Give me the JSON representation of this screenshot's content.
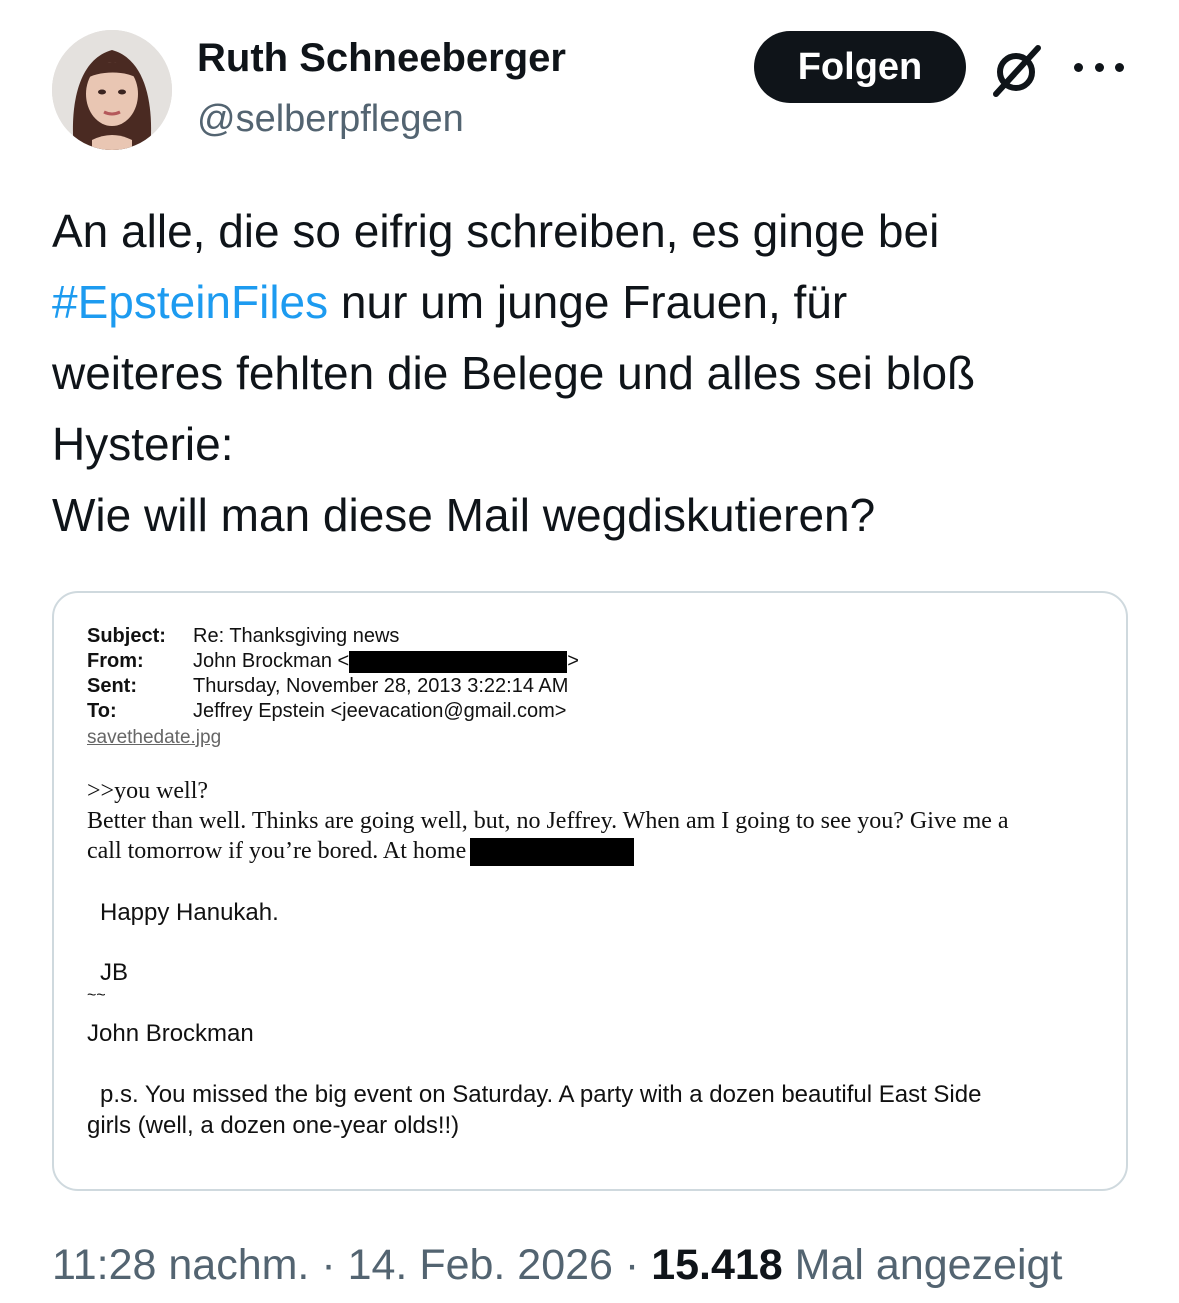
{
  "author": {
    "name": "Ruth Schneeberger",
    "handle": "@selberpflegen"
  },
  "actions": {
    "follow_label": "Folgen",
    "grok_icon": "grok-icon",
    "more_icon": "more-icon"
  },
  "tweet": {
    "line1": "An alle, die so eifrig schreiben, es ginge bei",
    "hashtag": "#EpsteinFiles",
    "line2_rest": " nur um junge Frauen, für",
    "line3": "weiteres fehlten die Belege und alles sei bloß",
    "line4": "Hysterie:",
    "line5": "Wie will man diese Mail wegdiskutieren?"
  },
  "email": {
    "subject_key": "Subject:",
    "subject": "Re: Thanksgiving news",
    "from_key": "From:",
    "from": "John Brockman <",
    "from_end": ">",
    "sent_key": "Sent:",
    "sent": "Thursday, November 28, 2013 3:22:14 AM",
    "to_key": "To:",
    "to": "Jeffrey Epstein <jeevacation@gmail.com>",
    "attachment": "savethedate.jpg",
    "quote": ">>you well?",
    "body1": "Better than well. Thinks are going well, but, no Jeffrey. When am I going to see you? Give me a",
    "body2": "call tomorrow if you’re bored. At home",
    "greeting": "Happy Hanukah.",
    "initials": "JB",
    "tilde": "~~",
    "signature": "John Brockman",
    "ps1": "p.s. You missed the big event on Saturday. A party with a dozen beautiful East Side",
    "ps2": "girls (well, a dozen one-year olds!!)"
  },
  "meta": {
    "time": "11:28 nachm.",
    "sep1": " · ",
    "date": "14. Feb. 2026",
    "sep2": " · ",
    "views": "15.418",
    "views_label": " Mal angezeigt"
  }
}
